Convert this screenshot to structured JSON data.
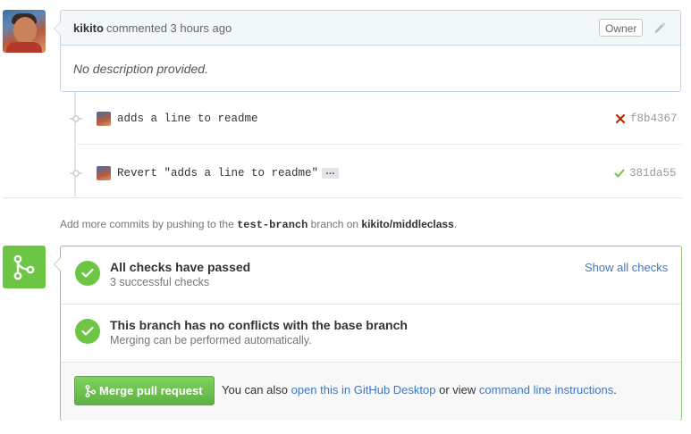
{
  "comment": {
    "author": "kikito",
    "meta": "commented 3 hours ago",
    "badge": "Owner",
    "body": "No description provided."
  },
  "commits": [
    {
      "message": "adds a line to readme",
      "status": "failed",
      "sha": "f8b4367"
    },
    {
      "message": "Revert \"adds a line to readme\"",
      "status": "success",
      "sha": "381da55",
      "ellipsis": "…"
    }
  ],
  "push_hint": {
    "prefix": "Add more commits by pushing to the",
    "branch": "test-branch",
    "middle": "branch on",
    "repo": "kikito/middleclass",
    "suffix": "."
  },
  "merge": {
    "checks_title": "All checks have passed",
    "checks_sub": "3 successful checks",
    "show_all": "Show all checks",
    "conflicts_title": "This branch has no conflicts with the base branch",
    "conflicts_sub": "Merging can be performed automatically.",
    "button_label": "Merge pull request",
    "alt_prefix": "You can also",
    "alt_link1": "open this in GitHub Desktop",
    "alt_middle": "or view",
    "alt_link2": "command line instructions",
    "alt_suffix": "."
  },
  "colors": {
    "success": "#6cc644",
    "failure": "#bd2c00",
    "link": "#4078c0"
  }
}
